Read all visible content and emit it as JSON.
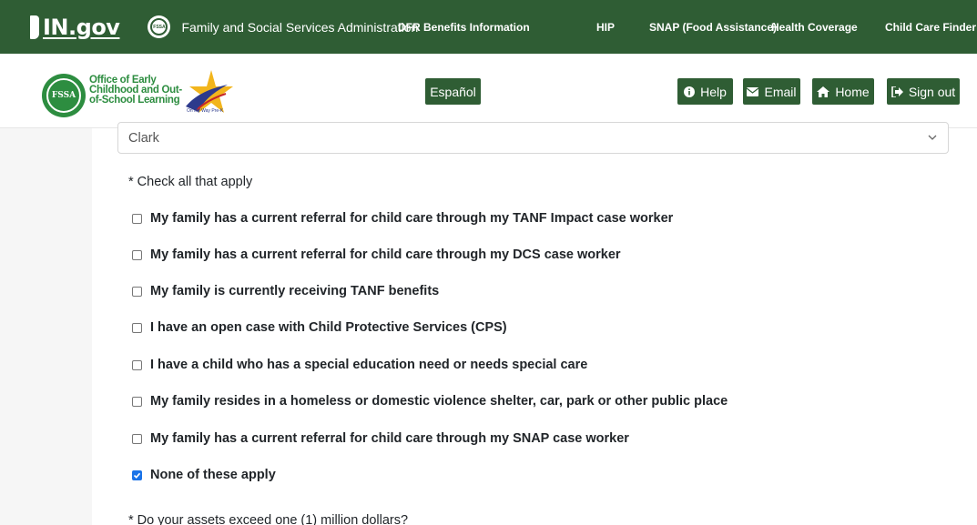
{
  "topbar": {
    "ingov_logo": {
      "prefix": "IN.",
      "suffix": "gov"
    },
    "fssa_seal_text": "FSSA",
    "agency_name": "Family and Social Services Administration",
    "nav": [
      {
        "label": "DFR Benefits Information"
      },
      {
        "label": "HIP"
      },
      {
        "label": "SNAP (Food Assistance)"
      },
      {
        "label": "Health Coverage"
      },
      {
        "label": "Child Care Finder"
      }
    ]
  },
  "header": {
    "seal_text": "FSSA",
    "office_name_lines": [
      "Office of Early",
      "Childhood and Out-",
      "of-School Learning"
    ],
    "omw_logo_text": "On My Way Pre-K",
    "language_button": "Español",
    "actions": [
      {
        "label": "Help",
        "icon": "info-circle-icon"
      },
      {
        "label": "Email",
        "icon": "envelope-icon"
      },
      {
        "label": "Home",
        "icon": "home-icon"
      },
      {
        "label": "Sign out",
        "icon": "sign-out-icon"
      }
    ]
  },
  "form": {
    "county_select": {
      "value": "Clark"
    },
    "check_all_label": "* Check all that apply",
    "options": [
      {
        "label": "My family has a current referral for child care through my TANF Impact case worker",
        "checked": false
      },
      {
        "label": "My family has a current referral for child care through my DCS case worker",
        "checked": false
      },
      {
        "label": "My family is currently receiving TANF benefits",
        "checked": false
      },
      {
        "label": "I have an open case with Child Protective Services (CPS)",
        "checked": false
      },
      {
        "label": "I have a child who has a special education need or needs special care",
        "checked": false
      },
      {
        "label": "My family resides in a homeless or domestic violence shelter, car, park or other public place",
        "checked": false
      },
      {
        "label": "My family has a current referral for child care through my SNAP case worker",
        "checked": false
      },
      {
        "label": "None of these apply",
        "checked": true
      }
    ],
    "assets_question": "* Do your assets exceed one (1) million dollars?"
  },
  "colors": {
    "brand_green": "#2f5d34",
    "logo_green": "#2d8d40",
    "checkbox_blue": "#1a73e8"
  }
}
